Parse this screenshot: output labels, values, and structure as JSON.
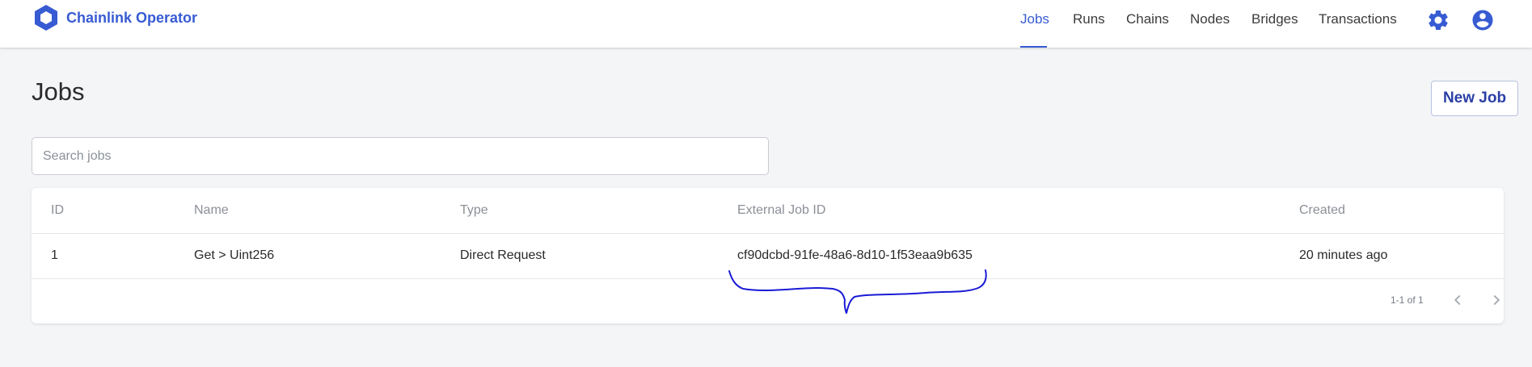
{
  "app": {
    "name": "Chainlink Operator",
    "brand_color": "#375bd2"
  },
  "nav": {
    "items": [
      {
        "label": "Jobs",
        "active": true
      },
      {
        "label": "Runs",
        "active": false
      },
      {
        "label": "Chains",
        "active": false
      },
      {
        "label": "Nodes",
        "active": false
      },
      {
        "label": "Bridges",
        "active": false
      },
      {
        "label": "Transactions",
        "active": false
      }
    ],
    "settings_icon": "gear-icon",
    "account_icon": "account-circle-icon"
  },
  "page": {
    "title": "Jobs",
    "new_job_label": "New Job"
  },
  "search": {
    "placeholder": "Search jobs",
    "value": ""
  },
  "table": {
    "headers": [
      "ID",
      "Name",
      "Type",
      "External Job ID",
      "Created"
    ],
    "rows": [
      [
        "1",
        "Get > Uint256",
        "Direct Request",
        "cf90dcbd-91fe-48a6-8d10-1f53eaa9b635",
        "20 minutes ago"
      ]
    ]
  },
  "pagination": {
    "range_text": "1-1 of 1",
    "prev_icon": "chevron-left-icon",
    "next_icon": "chevron-right-icon"
  },
  "annotation": {
    "color": "#1a1ad6",
    "shape": "curly-brace-under-external-job-id"
  }
}
